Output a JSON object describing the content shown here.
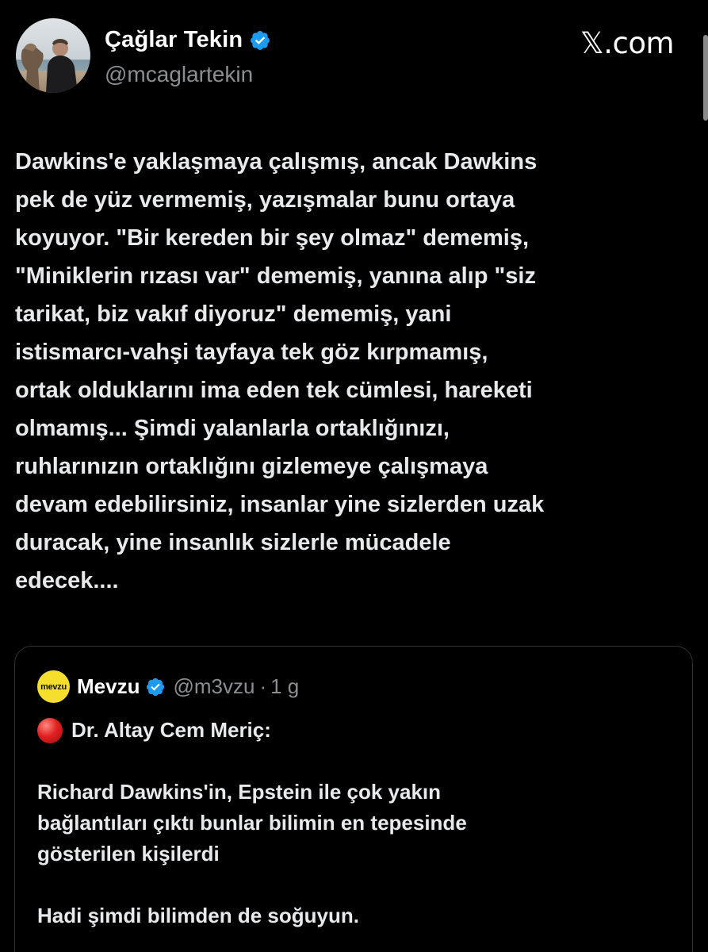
{
  "author": {
    "display_name": "Çağlar Tekin",
    "handle": "@mcaglartekin",
    "verified": true,
    "avatar_icon": "profile-photo-person-with-dog-at-beach"
  },
  "site_label": "𝕏.com",
  "tweet": {
    "lines": [
      "Dawkins'e yaklaşmaya çalışmış, ancak Dawkins",
      "pek de yüz vermemiş, yazışmalar bunu ortaya",
      "koyuyor. \"Bir kereden bir şey olmaz\" dememiş,",
      "\"Miniklerin rızası var\" dememiş, yanına alıp \"siz",
      "tarikat, biz vakıf diyoruz\" dememiş, yani",
      "istismarcı-vahşi tayfaya tek göz kırpmamış,",
      "ortak olduklarını ima eden tek cümlesi, hareketi",
      "olmamış... Şimdi yalanlarla ortaklığınızı,",
      "ruhlarınızın ortaklığını gizlemeye çalışmaya",
      "devam edebilirsiniz, insanlar yine sizlerden uzak",
      "duracak, yine insanlık sizlerle mücadele",
      "edecek...."
    ]
  },
  "quote": {
    "avatar_text": "mevzu",
    "display_name": "Mevzu",
    "verified": true,
    "handle": "@m3vzu",
    "separator": "·",
    "time": "1 g",
    "first_line": "Dr. Altay Cem Meriç:",
    "paragraph1": [
      "Richard Dawkins'in, Epstein ile çok yakın",
      "bağlantıları çıktı bunlar bilimin en tepesinde",
      "gösterilen kişilerdi"
    ],
    "paragraph2": [
      "Hadi şimdi bilimden de soğuyun."
    ]
  },
  "colors": {
    "background": "#000000",
    "text": "#e7e9ea",
    "secondary_text": "#8b8f94",
    "verified_blue": "#1d9bf0",
    "quote_border": "#2f3336",
    "mevzu_yellow": "#f5df2c"
  }
}
